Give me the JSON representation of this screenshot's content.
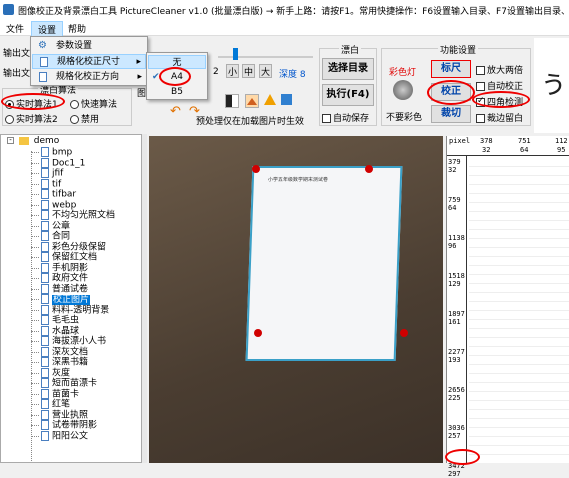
{
  "title": "图像校正及背景漂白工具 PictureCleaner v1.0 (批量漂白版) → 新手上路：请按F1。常用快捷操作：F6设置输入目录、F7设置输出目录、单击图",
  "menubar": [
    "文件",
    "设置",
    "帮助"
  ],
  "settings_menu": [
    "参数设置",
    "规格化校正尺寸",
    "规格化校正方向"
  ],
  "size_submenu": [
    "无",
    "A4",
    "B5"
  ],
  "size_selected": "A4",
  "left_labels": {
    "output1": "输出文",
    "output2": "输出文"
  },
  "bleach": {
    "title": "漂白",
    "select_dir": "选择目录",
    "run": "执行(F4)",
    "autosave": "自动保存"
  },
  "toolbar": {
    "small": "小",
    "mid": "中",
    "large": "大",
    "depth": "深度 8",
    "num2": "2",
    "img_label": "图",
    "preprocess": "预处理仅在加载图片时生效"
  },
  "func": {
    "title": "功能设置",
    "color": "彩色灯",
    "ruler": "标尺",
    "correct": "校正",
    "no_color": "不要彩色",
    "cut": "裁切",
    "enlarge": "放大两倍",
    "auto_corr": "自动校正",
    "four_corner": "四角检测",
    "crop_margin": "裁边留白"
  },
  "algo": {
    "title": "漂白算法",
    "realtime1": "实时算法1",
    "fast": "快速算法",
    "realtime2": "实时算法2",
    "disable": "禁用"
  },
  "tree": {
    "root": "demo",
    "items": [
      "bmp",
      "Doc1_1",
      "jfif",
      "tif",
      "tifbar",
      "webp",
      "不均匀光照文档",
      "公章",
      "合同",
      "彩色分级保留",
      "保留红文档",
      "手机阴影",
      "政府文件",
      "普通试卷",
      "校正图片",
      "料料-透明背景",
      "毛毛虫",
      "水晶球",
      "海拔漂小人书",
      "深灰文档",
      "深黑书籍",
      "灰度",
      "短而苗漂卡",
      "苗菌卡",
      "红笔",
      "营业执照",
      "试卷带阴影",
      "阳阳公文"
    ],
    "selected": "校正图片"
  },
  "ruler_top": {
    "pixel": "pixel",
    "v1": "378",
    "v2": "751",
    "v3": "112",
    "u1": "32",
    "u2": "64",
    "u3": "95"
  },
  "ruler_left": [
    "379\n32",
    "759\n64",
    "1138\n96",
    "1518\n129",
    "1897\n161",
    "2277\n193",
    "2656\n225",
    "3036\n257",
    "3472\n297"
  ],
  "doc_title": "小学五年级数学期末测试卷",
  "colors": {
    "accent": "#0078d7",
    "red": "#e00000",
    "selected": "#cce8ff"
  }
}
